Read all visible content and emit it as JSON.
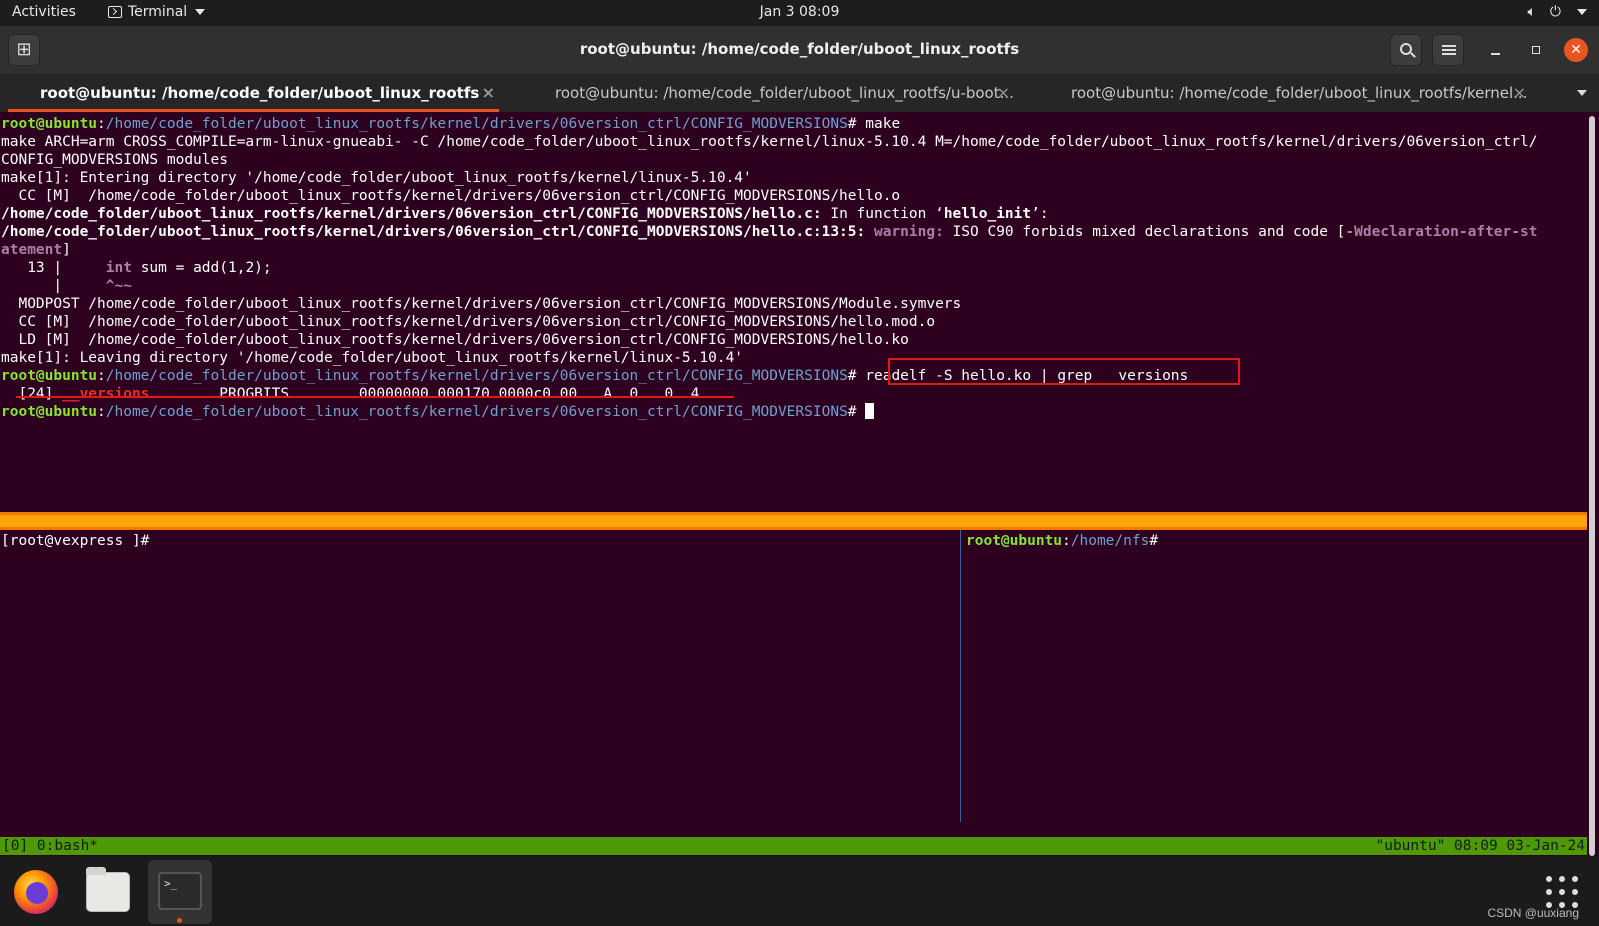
{
  "topbar": {
    "activities": "Activities",
    "app_menu": "Terminal",
    "clock": "Jan 3  08:09",
    "volume_icon": "speaker-icon",
    "power_icon": "power-icon"
  },
  "window": {
    "title": "root@ubuntu: /home/code_folder/uboot_linux_rootfs",
    "close_glyph": "✕"
  },
  "tabs": [
    {
      "label": "root@ubuntu: /home/code_folder/uboot_linux_rootfs",
      "active": true
    },
    {
      "label": "root@ubuntu: /home/code_folder/uboot_linux_rootfs/u-boot...",
      "active": false
    },
    {
      "label": "root@ubuntu: /home/code_folder/uboot_linux_rootfs/kernel...",
      "active": false
    }
  ],
  "tab_close_glyph": "×",
  "terminal_top": {
    "prompt_user": "root@ubuntu",
    "prompt_path": "/home/code_folder/uboot_linux_rootfs/kernel/drivers/06version_ctrl/CONFIG_MODVERSIONS",
    "prompt_sep": ":",
    "prompt_hash": "#",
    "cmd_make": " make",
    "l2": "make ARCH=arm CROSS_COMPILE=arm-linux-gnueabi- -C /home/code_folder/uboot_linux_rootfs/kernel/linux-5.10.4 M=/home/code_folder/uboot_linux_rootfs/kernel/drivers/06version_ctrl/",
    "l3": "CONFIG_MODVERSIONS modules",
    "l4": "make[1]: Entering directory '/home/code_folder/uboot_linux_rootfs/kernel/linux-5.10.4'",
    "l5": "  CC [M]  /home/code_folder/uboot_linux_rootfs/kernel/drivers/06version_ctrl/CONFIG_MODVERSIONS/hello.o",
    "l6_file": "/home/code_folder/uboot_linux_rootfs/kernel/drivers/06version_ctrl/CONFIG_MODVERSIONS/hello.c:",
    "l6_mid": " In function ‘",
    "l6_fn": "hello_init",
    "l6_end": "’:",
    "l7_file": "/home/code_folder/uboot_linux_rootfs/kernel/drivers/06version_ctrl/CONFIG_MODVERSIONS/hello.c:13:5:",
    "l7_warning": " warning:",
    "l7_msg": " ISO C90 forbids mixed declarations and code [",
    "l7_flag": "-Wdeclaration-after-st",
    "l8_flag": "atement",
    "l8_end": "]",
    "l9_pre": "   13 |     ",
    "l9_kw": "int",
    "l9_post": " sum = add(1,2);",
    "l10_pre": "      |     ",
    "l10_caret": "^~~",
    "l11": "  MODPOST /home/code_folder/uboot_linux_rootfs/kernel/drivers/06version_ctrl/CONFIG_MODVERSIONS/Module.symvers",
    "l12": "  CC [M]  /home/code_folder/uboot_linux_rootfs/kernel/drivers/06version_ctrl/CONFIG_MODVERSIONS/hello.mod.o",
    "l13": "  LD [M]  /home/code_folder/uboot_linux_rootfs/kernel/drivers/06version_ctrl/CONFIG_MODVERSIONS/hello.ko",
    "l14": "make[1]: Leaving directory '/home/code_folder/uboot_linux_rootfs/kernel/linux-5.10.4'",
    "cmd_readelf": " readelf -S hello.ko | grep __versions",
    "l16_pre": "  [24] ",
    "l16_name": "__versions",
    "l16_post": "        PROGBITS        00000000 000170 0000c0 00   A  0   0  4",
    "cmd_final": " "
  },
  "pane_bottom_left": {
    "prompt": "[root@vexpress ]#"
  },
  "pane_bottom_right": {
    "prompt_user": "root@ubuntu",
    "prompt_sep": ":",
    "prompt_path": "/home/nfs",
    "prompt_hash": "#"
  },
  "tmux_status": {
    "left": "[0] 0:bash*",
    "right": "\"ubuntu\" 08:09 03-Jan-24"
  },
  "dock": {
    "items": [
      "firefox-icon",
      "files-icon",
      "terminal-icon"
    ],
    "terminal_glyph": ">_",
    "watermark": "CSDN @uuxiang"
  },
  "colors": {
    "terminal_bg": "#2c001e",
    "prompt_user": "#8ae234",
    "prompt_path": "#729fcf",
    "warning": "#ad7fa8",
    "match": "#ef2929",
    "tmux_divider": "#ffa30a",
    "tmux_status": "#4e9a06",
    "accent": "#e95420",
    "annotation": "#e3171a"
  }
}
